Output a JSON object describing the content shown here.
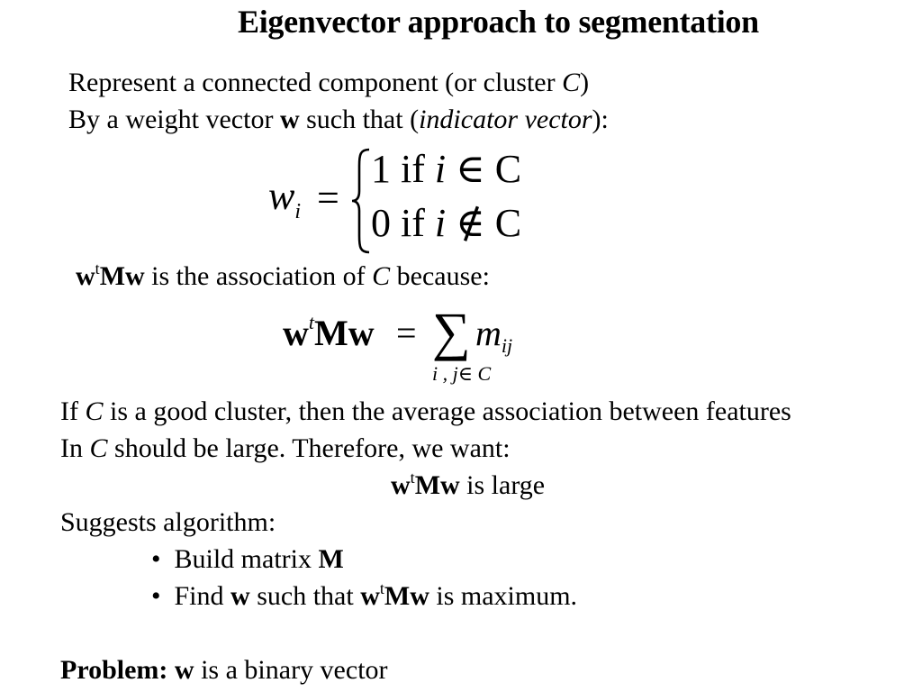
{
  "slide": {
    "title": "Eigenvector approach to segmentation",
    "intro": {
      "line1_pre": "Represent a connected component (or cluster ",
      "line1_var": "C",
      "line1_post": ")",
      "line2_pre": "By  a weight vector ",
      "line2_bold": "w",
      "line2_mid": " such that (",
      "line2_italic": "indicator vector",
      "line2_post": "):"
    },
    "equation_piecewise": {
      "lhs": "w",
      "lhs_sub": "i",
      "equals": "=",
      "case1_value": "1",
      "case1_cond_if": "if",
      "case1_var": "i",
      "case1_rel": "∈",
      "case1_set": "C",
      "case2_value": "0",
      "case2_cond_if": "if",
      "case2_var": "i",
      "case2_rel": "∉",
      "case2_set": "C"
    },
    "association": {
      "w": "w",
      "t": "t",
      "Mw": "Mw",
      "text_pre": " is the association of ",
      "var": "C",
      "text_post": " because:"
    },
    "equation_sum": {
      "lhs_w": "w",
      "lhs_t": "t",
      "lhs_Mw": "Mw",
      "equals": "=",
      "sigma": "∑",
      "term": "m",
      "term_sub": "ij",
      "under": "i , j∈ C"
    },
    "reasoning": {
      "line1_pre": "If ",
      "line1_var": "C",
      "line1_post": " is a good cluster, then the average association between features",
      "line2_pre": "In ",
      "line2_var": "C",
      "line2_post": " should be large. Therefore, we want:",
      "line3_w": "w",
      "line3_t": "t",
      "line3_Mw": "Mw",
      "line3_post": " is large"
    },
    "algorithm": {
      "heading": "Suggests algorithm:",
      "bullet_char": "•",
      "item1_text": "Build matrix ",
      "item1_bold": "M",
      "item2_pre": "Find ",
      "item2_w": "w",
      "item2_mid": " such that ",
      "item2_w2": "w",
      "item2_t": "t",
      "item2_Mw": "Mw",
      "item2_post": " is maximum."
    },
    "problem": {
      "label": "Problem: ",
      "w": "w",
      "text": " is a binary vector"
    }
  }
}
